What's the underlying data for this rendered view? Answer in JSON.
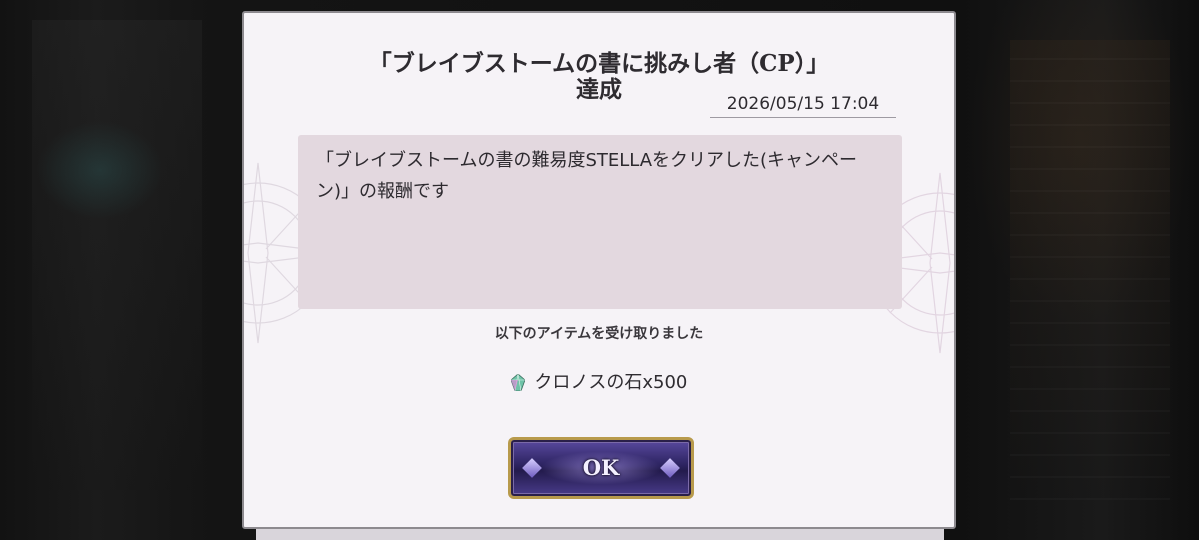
{
  "dialog": {
    "title_line1": "「ブレイブストームの書に挑みし者（CP）」",
    "title_line2": "達成",
    "date": "2026/05/15 17:04",
    "message": "「ブレイブストームの書の難易度STELLAをクリアした(キャンペーン)」の報酬です",
    "received_label": "以下のアイテムを受け取りました",
    "reward": {
      "icon": "chronos-stone-icon",
      "text": "クロノスの石x500"
    },
    "ok_label": "OK"
  },
  "colors": {
    "panel": "#f6f3f7",
    "message_box": "#e3d8df",
    "button_face": "#2c2360",
    "button_border": "#b89a4c"
  }
}
